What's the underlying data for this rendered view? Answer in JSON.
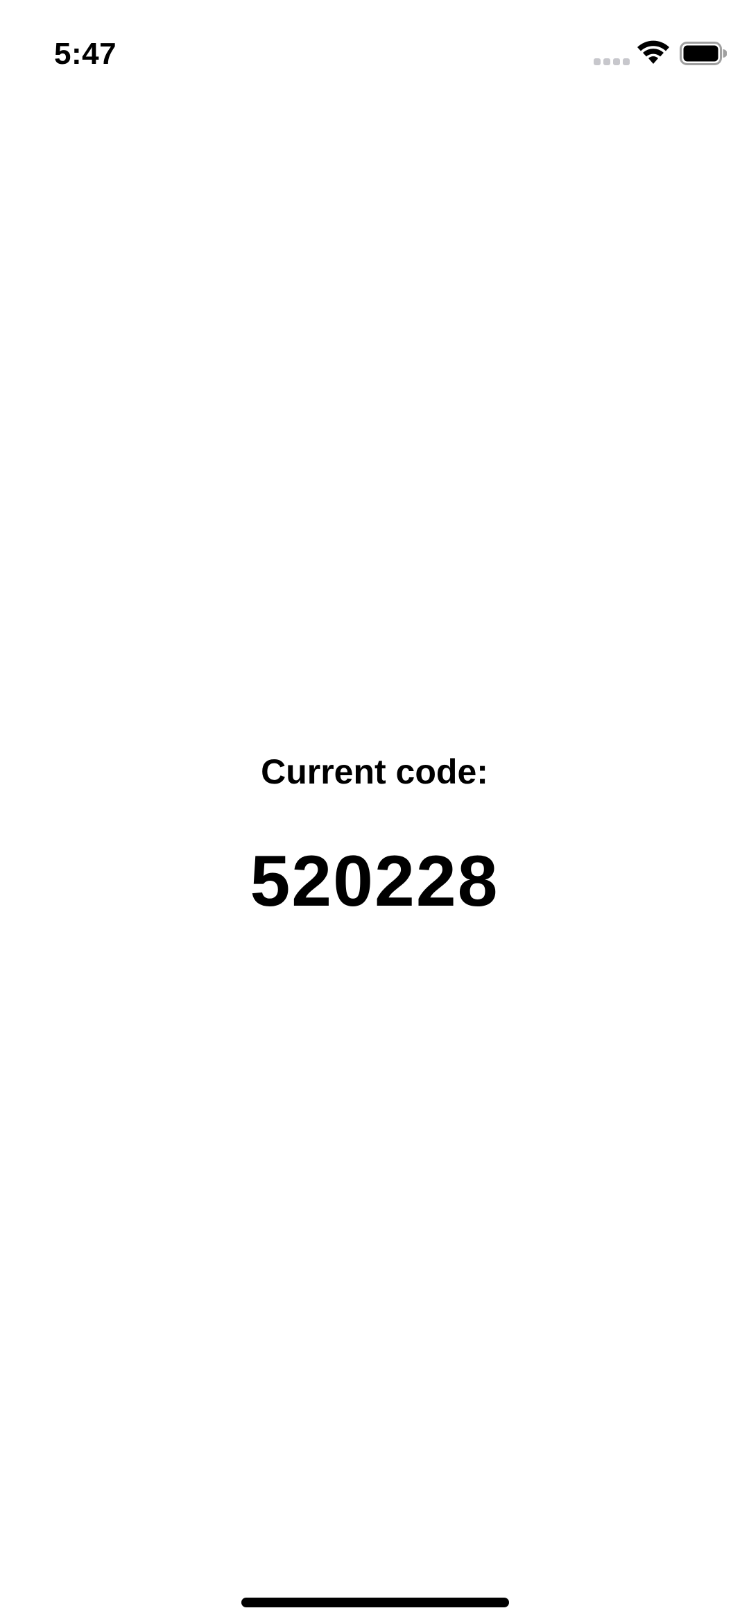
{
  "status_bar": {
    "time": "5:47",
    "icons": [
      "signal-icon",
      "wifi-icon",
      "battery-icon"
    ]
  },
  "main": {
    "label": "Current code:",
    "code": "520228"
  },
  "colors": {
    "background": "#ffffff",
    "text": "#000000",
    "inactive_signal": "#c7c7cc"
  }
}
